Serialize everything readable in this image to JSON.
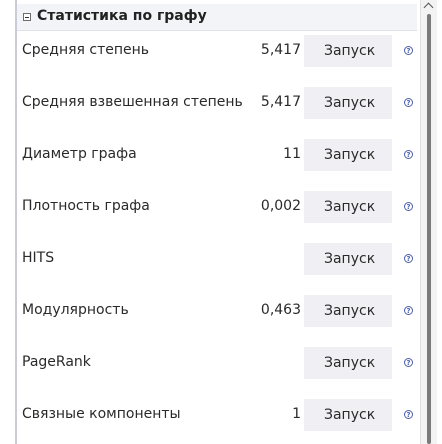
{
  "section": {
    "title": "Статистика по графу"
  },
  "stats": [
    {
      "label": "Средняя степень",
      "value": "5,417",
      "action": "Запуск"
    },
    {
      "label": "Средняя взвешенная степень",
      "value": "5,417",
      "action": "Запуск"
    },
    {
      "label": "Диаметр графа",
      "value": "11",
      "action": "Запуск"
    },
    {
      "label": "Плотность графа",
      "value": "0,002",
      "action": "Запуск"
    },
    {
      "label": "HITS",
      "value": "",
      "action": "Запуск"
    },
    {
      "label": "Модулярность",
      "value": "0,463",
      "action": "Запуск"
    },
    {
      "label": "PageRank",
      "value": "",
      "action": "Запуск"
    },
    {
      "label": "Связные компоненты",
      "value": "1",
      "action": "Запуск"
    }
  ],
  "help_icon": "help-circle-icon",
  "colors": {
    "help_icon": "#4b5fae",
    "run_button_bg": "#f0f0f4",
    "header_bg": "#f3f4f8"
  }
}
